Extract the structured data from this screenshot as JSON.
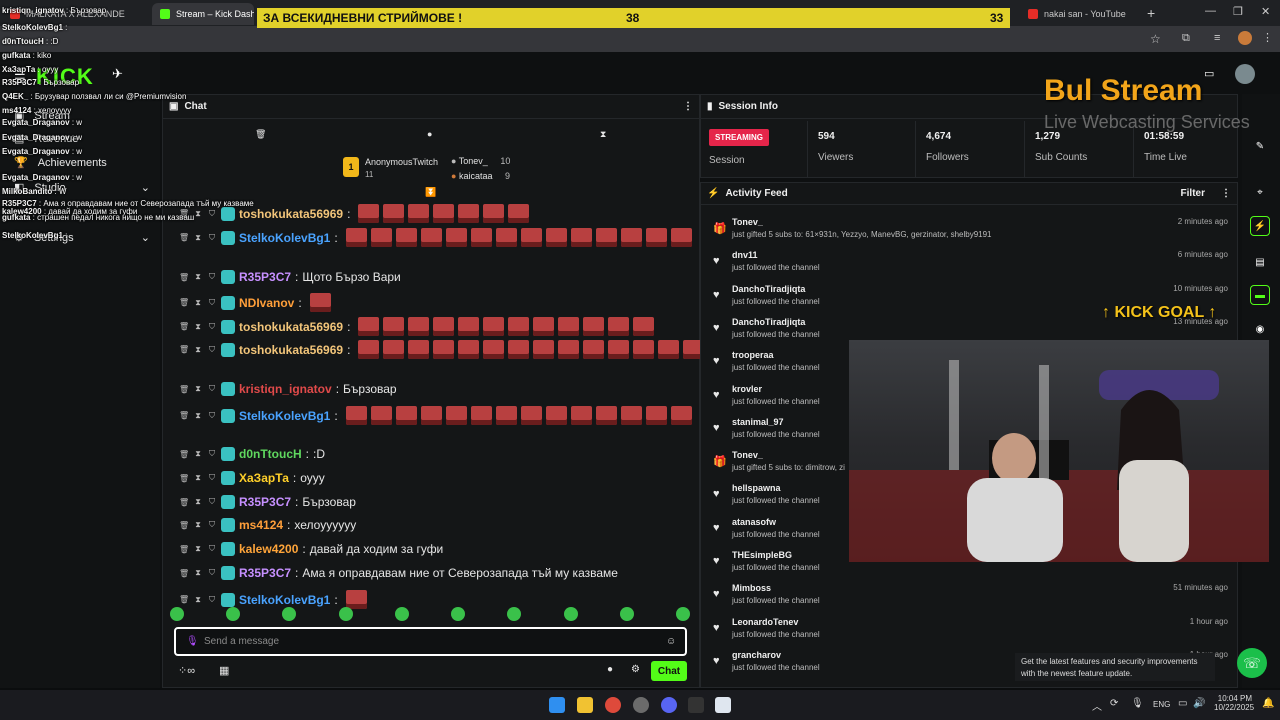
{
  "browser": {
    "tabs": [
      {
        "label": "MALKATA X ALEXANDE",
        "active": false
      },
      {
        "label": "Stream – Kick Dashboar",
        "active": true
      },
      {
        "label": "nakai san - YouTube",
        "active": false
      }
    ]
  },
  "banner": {
    "text": "ЗА ВСЕКИДНЕВНИ СТРИЙМОВЕ !",
    "num1": "38",
    "num2": "33"
  },
  "sidebar": {
    "logo": "KICK",
    "items": [
      {
        "label": "Stream"
      },
      {
        "label": "Revenue"
      },
      {
        "label": "Achievements"
      },
      {
        "label": "Studio"
      },
      {
        "label": "Settings"
      }
    ]
  },
  "chat": {
    "title": "Chat",
    "leaderboard": {
      "top": {
        "name": "AnonymousTwitch",
        "count": "11"
      },
      "second": {
        "name": "Tonev_",
        "count": "10"
      },
      "third": {
        "name": "kaicataa",
        "count": "9"
      }
    },
    "messages": [
      {
        "user": "toshokukata56969",
        "text": "",
        "color": "#f2c57a",
        "emotes": 7
      },
      {
        "user": "StelkoKolevBg1",
        "text": "",
        "color": "#4aa3ff",
        "emotes": 14
      },
      {
        "user": "R35P3C7",
        "text": "Щото Бързо Вари",
        "color": "#c690ff",
        "emotes": 0
      },
      {
        "user": "NDIvanov",
        "text": "",
        "color": "#ff9f3a",
        "emotes": 1
      },
      {
        "user": "toshokukata56969",
        "text": "",
        "color": "#f2c57a",
        "emotes": 12
      },
      {
        "user": "toshokukata56969",
        "text": "",
        "color": "#f2c57a",
        "emotes": 18
      },
      {
        "user": "kristiqn_ignatov",
        "text": "Бързовар",
        "color": "#e04a4a",
        "emotes": 0
      },
      {
        "user": "StelkoKolevBg1",
        "text": "",
        "color": "#4aa3ff",
        "emotes": 17
      },
      {
        "user": "d0nTtoucH",
        "text": ":D",
        "color": "#5fd85f",
        "emotes": 0
      },
      {
        "user": "ХаЗарТа",
        "text": "оууу",
        "color": "#ffd02a",
        "emotes": 0
      },
      {
        "user": "R35P3C7",
        "text": "Бързовар",
        "color": "#c690ff",
        "emotes": 0
      },
      {
        "user": "ms4124",
        "text": "хелоуууууу",
        "color": "#ff9f3a",
        "emotes": 0
      },
      {
        "user": "kalew4200",
        "text": "давай да ходим за гуфи",
        "color": "#ffa53a",
        "emotes": 0
      },
      {
        "user": "R35P3C7",
        "text": "Ама я оправдавам ние от Северозапада тъй му казваме",
        "color": "#c690ff",
        "emotes": 0
      },
      {
        "user": "StelkoKolevBg1",
        "text": "",
        "color": "#4aa3ff",
        "emotes": 1
      }
    ],
    "input_placeholder": "Send a message",
    "send_label": "Chat"
  },
  "session": {
    "title": "Session Info",
    "status": "STREAMING",
    "status_label": "Session",
    "stats": [
      {
        "value": "594",
        "label": "Viewers"
      },
      {
        "value": "4,674",
        "label": "Followers"
      },
      {
        "value": "1,279",
        "label": "Sub Counts"
      },
      {
        "value": "01:58:59",
        "label": "Time Live"
      }
    ]
  },
  "activity": {
    "title": "Activity Feed",
    "filter_label": "Filter",
    "items": [
      {
        "name": "Tonev_",
        "sub": "just gifted 5 subs to: 61×931n, Yezzyo, ManevBG, gerzinator, shelby9191",
        "time": "2 minutes ago",
        "type": "gift"
      },
      {
        "name": "dnv11",
        "sub": "just followed the channel",
        "time": "6 minutes ago",
        "type": "follow"
      },
      {
        "name": "DanchoTiradjiqta",
        "sub": "just followed the channel",
        "time": "10 minutes ago",
        "type": "follow"
      },
      {
        "name": "DanchoTiradjiqta",
        "sub": "just followed the channel",
        "time": "13 minutes ago",
        "type": "follow"
      },
      {
        "name": "trooperaa",
        "sub": "just followed the channel",
        "time": "",
        "type": "follow"
      },
      {
        "name": "krovler",
        "sub": "just followed the channel",
        "time": "",
        "type": "follow"
      },
      {
        "name": "stanimal_97",
        "sub": "just followed the channel",
        "time": "",
        "type": "follow"
      },
      {
        "name": "Tonev_",
        "sub": "just gifted 5 subs to: dimitrow, zi",
        "time": "",
        "type": "gift"
      },
      {
        "name": "hellspawna",
        "sub": "just followed the channel",
        "time": "",
        "type": "follow"
      },
      {
        "name": "atanasofw",
        "sub": "just followed the channel",
        "time": "",
        "type": "follow"
      },
      {
        "name": "THEsimpleBG",
        "sub": "just followed the channel",
        "time": "",
        "type": "follow"
      },
      {
        "name": "Mimboss",
        "sub": "just followed the channel",
        "time": "51 minutes ago",
        "type": "follow"
      },
      {
        "name": "LeonardoTenev",
        "sub": "just followed the channel",
        "time": "1 hour ago",
        "type": "follow"
      },
      {
        "name": "grancharov",
        "sub": "just followed the channel",
        "time": "1 hour ago",
        "type": "follow"
      }
    ]
  },
  "overlay": {
    "brand_line1": "Bul Stream",
    "brand_line2": "Live Webcasting Services",
    "kick_goal": "KICK GOAL",
    "chat_lines": [
      {
        "user": "kristiqn_ignatov",
        "text": "Бързовар"
      },
      {
        "user": "StelkoKolevBg1",
        "text": ""
      },
      {
        "user": "d0nTtoucH",
        "text": ":D"
      },
      {
        "user": "gufkata",
        "text": "kiko"
      },
      {
        "user": "ХаЗарТа",
        "text": "оууу"
      },
      {
        "user": "R35P3C7",
        "text": "Бързовар"
      },
      {
        "user": "Q4EK_",
        "text": "Брузувар ползвал ли си @Premiumvision"
      },
      {
        "user": "ms4124",
        "text": "хелоуууу"
      },
      {
        "user": "Evgata_Draganov",
        "text": "w"
      },
      {
        "user": "Evgata_Draganov",
        "text": "w"
      },
      {
        "user": "Evgata_Draganov",
        "text": "w"
      },
      {
        "user": "kalew4200",
        "text": "давай да ходим за гуфи"
      },
      {
        "user": "Evgata_Draganov",
        "text": "w"
      },
      {
        "user": "MilkoBandito",
        "text": "W"
      },
      {
        "user": "R35P3C7",
        "text": "Ама я оправдавам ние от Северозапада тъй му казваме"
      },
      {
        "user": "gufkata",
        "text": "страшен педал никога нищо не ми казваш"
      },
      {
        "user": "StelkoKolevBg1",
        "text": ""
      }
    ]
  },
  "notification": "Get the latest features and security improvements with the newest feature update.",
  "taskbar": {
    "lang": "ENG",
    "time": "10:04 PM",
    "date": "10/22/2025"
  },
  "colors": {
    "kick_green": "#53fc18",
    "streaming_red": "#e5254a",
    "banner_yellow": "#e1d12a"
  }
}
